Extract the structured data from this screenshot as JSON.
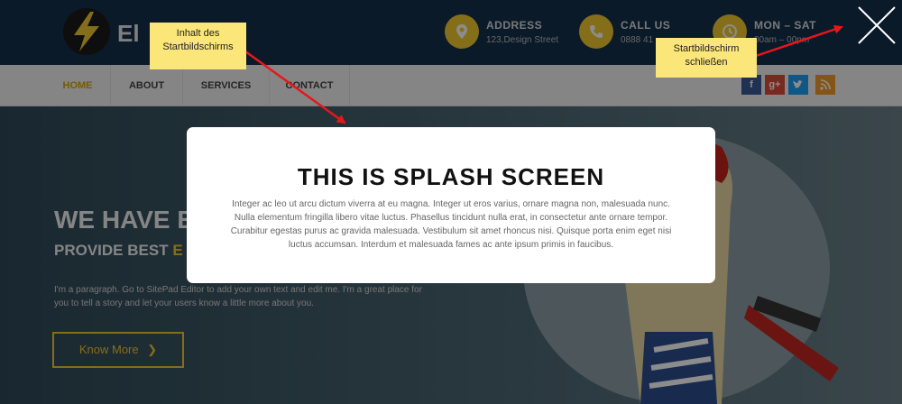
{
  "header": {
    "logo_text": "El",
    "info": [
      {
        "icon": "map-pin-icon",
        "title": "ADDRESS",
        "subtitle": "123,Design Street"
      },
      {
        "icon": "phone-icon",
        "title": "CALL US",
        "subtitle": "0888 41"
      },
      {
        "icon": "clock-icon",
        "title": "MON – SAT",
        "subtitle": "00am – 00pm"
      }
    ],
    "accent_color": "#f2c82f"
  },
  "nav": {
    "items": [
      "HOME",
      "ABOUT",
      "SERVICES",
      "CONTACT"
    ],
    "active": "HOME"
  },
  "social": [
    "facebook-icon",
    "google-plus-icon",
    "twitter-icon",
    "rss-icon"
  ],
  "hero": {
    "heading": "WE HAVE E",
    "subheading_prefix": "PROVIDE BEST ",
    "subheading_highlight": "E",
    "paragraph": "I'm a paragraph. Go to SitePad Editor to add your own text and edit me. I'm a great place for you to tell a story and let your users know a little more about you.",
    "button_label": "Know More"
  },
  "splash": {
    "title": "THIS IS SPLASH SCREEN",
    "body": "Integer ac leo ut arcu dictum viverra at eu magna. Integer ut eros varius, ornare magna non, malesuada nunc. Nulla elementum fringilla libero vitae luctus. Phasellus tincidunt nulla erat, in consectetur ante ornare tempor. Curabitur egestas purus ac gravida malesuada. Vestibulum sit amet rhoncus nisi. Quisque porta enim eget nisi luctus accumsan. Interdum et malesuada fames ac ante ipsum primis in faucibus."
  },
  "annotations": {
    "content_label": "Inhalt des Startbildschirms",
    "close_label": "Startbildschirm schließen",
    "arrow_color": "#e8161b"
  }
}
